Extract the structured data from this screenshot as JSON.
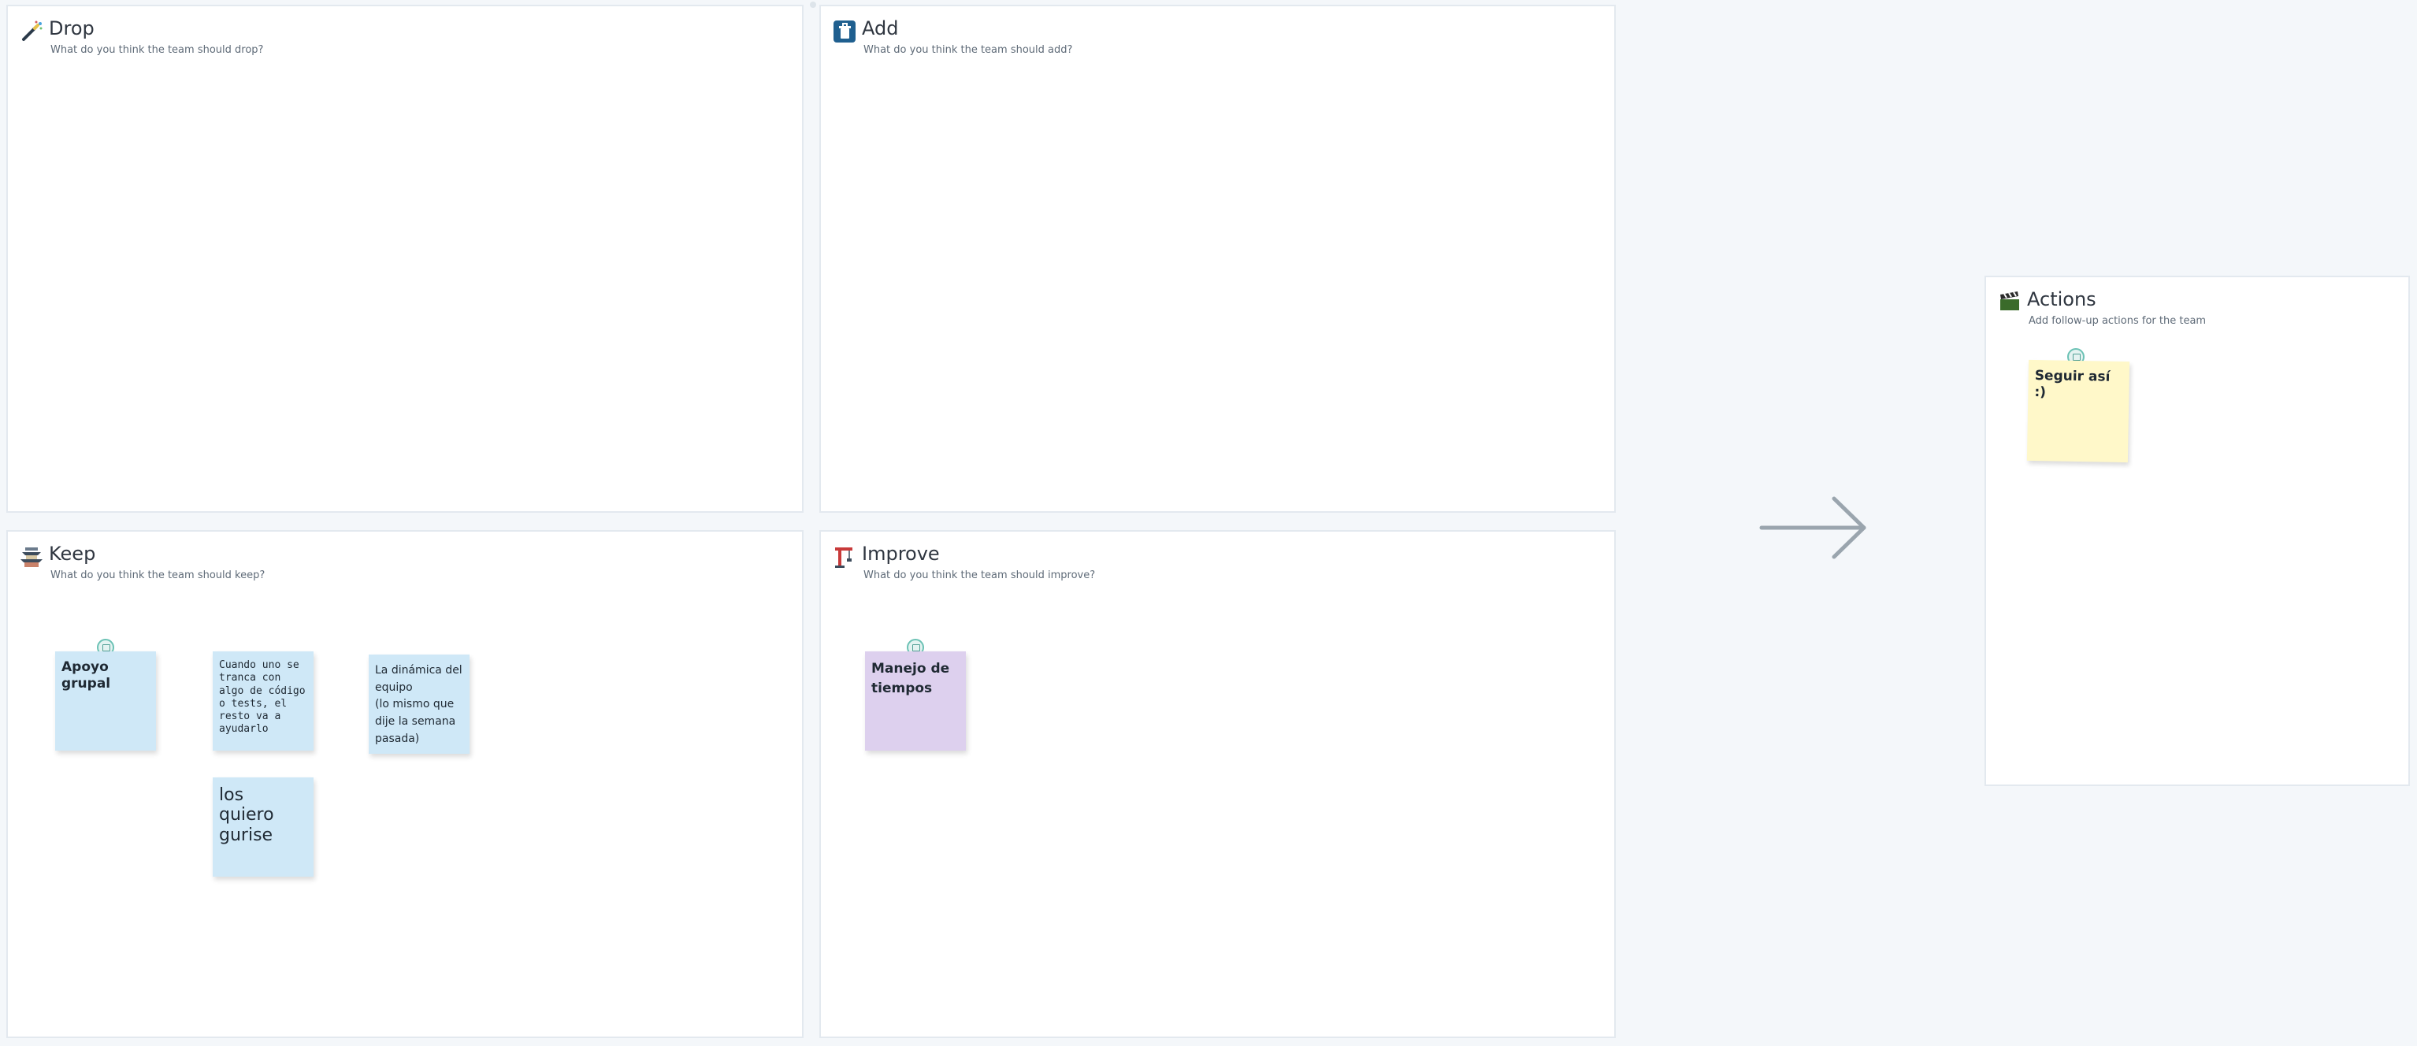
{
  "board": {
    "drop": {
      "title": "Drop",
      "subtitle": "What do you think the team should drop?"
    },
    "add": {
      "title": "Add",
      "subtitle": "What do you think the team should add?"
    },
    "keep": {
      "title": "Keep",
      "subtitle": "What do you think the team should keep?"
    },
    "improve": {
      "title": "Improve",
      "subtitle": "What do you think the team should improve?"
    },
    "actions": {
      "title": "Actions",
      "subtitle": "Add follow-up actions for the team"
    }
  },
  "notes": {
    "keep": [
      {
        "text": "Apoyo grupal"
      },
      {
        "text": "Cuando uno se tranca con algo de código o tests, el resto va a ayudarlo"
      },
      {
        "text": "La dinámica del equipo\n(lo mismo que dije la semana pasada)"
      },
      {
        "text": "los\nquiero\ngurise"
      }
    ],
    "improve": [
      {
        "text": "Manejo de tiempos"
      }
    ],
    "actions": [
      {
        "text": "Seguir así :)"
      }
    ]
  },
  "icons": {
    "drop": "wand-icon",
    "add": "recycle-bin-icon",
    "keep": "pagoda-icon",
    "improve": "crane-icon",
    "actions": "clapperboard-icon",
    "arrow": "arrow-right-icon"
  },
  "colors": {
    "note_blue": "#cfe8f7",
    "note_purple": "#ddd0ee",
    "note_yellow": "#fff8c9",
    "arrow": "#9aa5ae"
  }
}
